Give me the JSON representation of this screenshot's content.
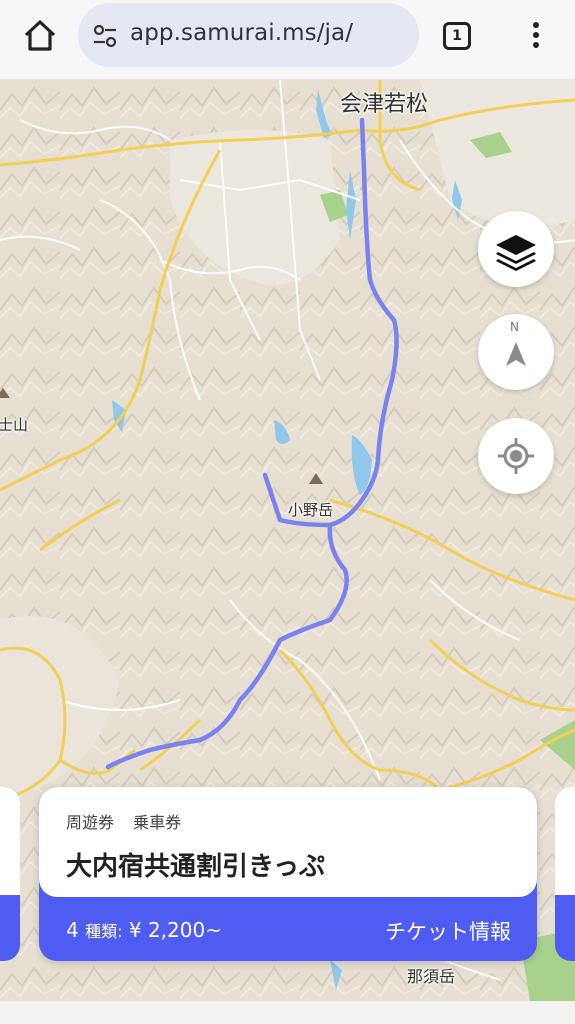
{
  "browser": {
    "url": "app.samurai.ms/ja/",
    "tab_count": "1"
  },
  "map": {
    "places": {
      "aizuwakamatsu": "会津若松",
      "onodake": "小野岳",
      "nasudake": "那須岳",
      "left_peak_partial": "士山"
    },
    "route_color": "#7a82f0"
  },
  "controls": {
    "layers": "layers-icon",
    "compass_label": "N",
    "locate": "my-location-icon"
  },
  "ticket": {
    "tags": [
      "周遊券",
      "乗車券"
    ],
    "title": "大内宿共通割引きっぷ",
    "count_number": "4",
    "count_unit": "種類:",
    "price": "¥ 2,200~",
    "info_link": "チケット情報"
  },
  "colors": {
    "accent": "#4f5cf2"
  }
}
